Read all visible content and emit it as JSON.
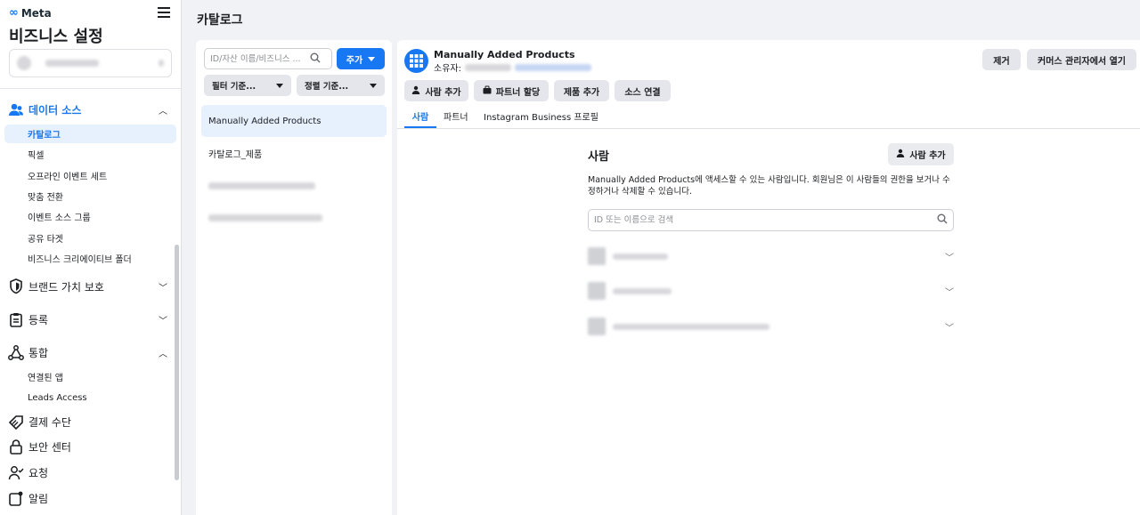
{
  "nav": {
    "brand": "Meta",
    "title": "비즈니스 설정",
    "groups": [
      {
        "label": "데이터 소스",
        "icon": "people-icon"
      },
      {
        "label": "브랜드 가치 보호",
        "icon": "shield-icon"
      },
      {
        "label": "등록",
        "icon": "clipboard-icon"
      },
      {
        "label": "통합",
        "icon": "nodes-icon"
      },
      {
        "label": "결제 수단",
        "icon": "tag-icon"
      },
      {
        "label": "보안 센터",
        "icon": "lock-icon"
      },
      {
        "label": "요청",
        "icon": "person-check-icon"
      },
      {
        "label": "알림",
        "icon": "notification-icon"
      }
    ],
    "data_source_items": [
      "카탈로그",
      "픽셀",
      "오프라인 이벤트 세트",
      "맞춤 전환",
      "이벤트 소스 그룹",
      "공유 타겟",
      "비즈니스 크리에이티브 폴더"
    ],
    "integration_items": [
      "연결된 앱",
      "Leads Access"
    ]
  },
  "page": {
    "title": "카탈로그"
  },
  "list": {
    "search_placeholder": "ID/자산 이름/비즈니스 ...",
    "add_label": "주가",
    "filter_label": "필터 기준...",
    "sort_label": "정렬 기준...",
    "items": [
      "Manually Added Products",
      "카탈로그_제품"
    ]
  },
  "detail": {
    "catalog_name": "Manually Added Products",
    "owner_label": "소유자:",
    "remove_label": "제거",
    "open_commerce_label": "커머스 관리자에서 열기",
    "actions": [
      "사람 추가",
      "파트너 할당",
      "제품 추가",
      "소스 연결"
    ],
    "tabs": [
      "사람",
      "파트너",
      "Instagram Business 프로필"
    ],
    "people": {
      "title": "사람",
      "add_label": "사람 추가",
      "description": "Manually Added Products에 액세스할 수 있는 사람입니다. 회원님은 이 사람들의 권한을 보거나 수정하거나 삭제할 수 있습니다.",
      "search_placeholder": "ID 또는 이름으로 검색"
    }
  },
  "colors": {
    "accent": "#1877f2",
    "active_bg": "#e7f0fd",
    "gray_button": "#e4e6eb"
  }
}
